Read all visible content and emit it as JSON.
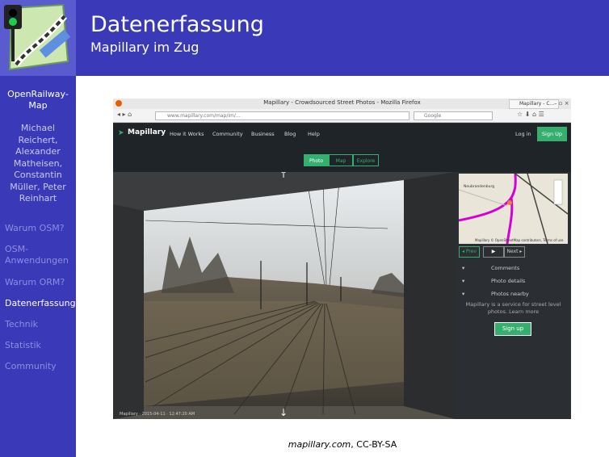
{
  "slide": {
    "title": "Datenerfassung",
    "subtitle": "Mapillary im Zug"
  },
  "sidebar": {
    "project": "OpenRailway-Map",
    "authors": "Michael Reichert, Alexander Matheisen, Constantin Müller, Peter Reinhart",
    "items": [
      {
        "label": "Warum OSM?",
        "active": false
      },
      {
        "label": "OSM-Anwendungen",
        "active": false
      },
      {
        "label": "Warum ORM?",
        "active": false
      },
      {
        "label": "Datenerfassung",
        "active": true
      },
      {
        "label": "Technik",
        "active": false
      },
      {
        "label": "Statistik",
        "active": false
      },
      {
        "label": "Community",
        "active": false
      }
    ]
  },
  "screenshot": {
    "window_title": "Mapillary - Crowdsourced Street Photos - Mozilla Firefox",
    "tab_label": "Mapillary - C...",
    "url": "www.mapillary.com/map/im/...",
    "search_placeholder": "Google",
    "brand": "Mapillary",
    "nav_links": [
      "How it Works",
      "Community",
      "Business",
      "Blog",
      "Help"
    ],
    "login": "Log in",
    "signup": "Sign Up",
    "modes": [
      "Photo",
      "Map",
      "Explore"
    ],
    "map_labels": [
      "Neubrandenburg",
      "Mapillary © OpenStreetMap contributors, Terms of use"
    ],
    "panel_buttons": [
      "◂ Prev",
      "▶",
      "Next ▸"
    ],
    "panel_sections": [
      "Comments",
      "Photo details",
      "Photos nearby"
    ],
    "panel_text": "Mapillary is a service for street level photos. Learn more",
    "panel_signup": "Sign up",
    "photo_footer": "Mapillary · 2015-04-11 · 12:47:20 AM",
    "colors": {
      "accent": "#35af6d",
      "header": "#3a3ab8",
      "dark": "#1f2428"
    }
  },
  "caption": {
    "link": "mapillary.com",
    "license": ", CC-BY-SA"
  }
}
